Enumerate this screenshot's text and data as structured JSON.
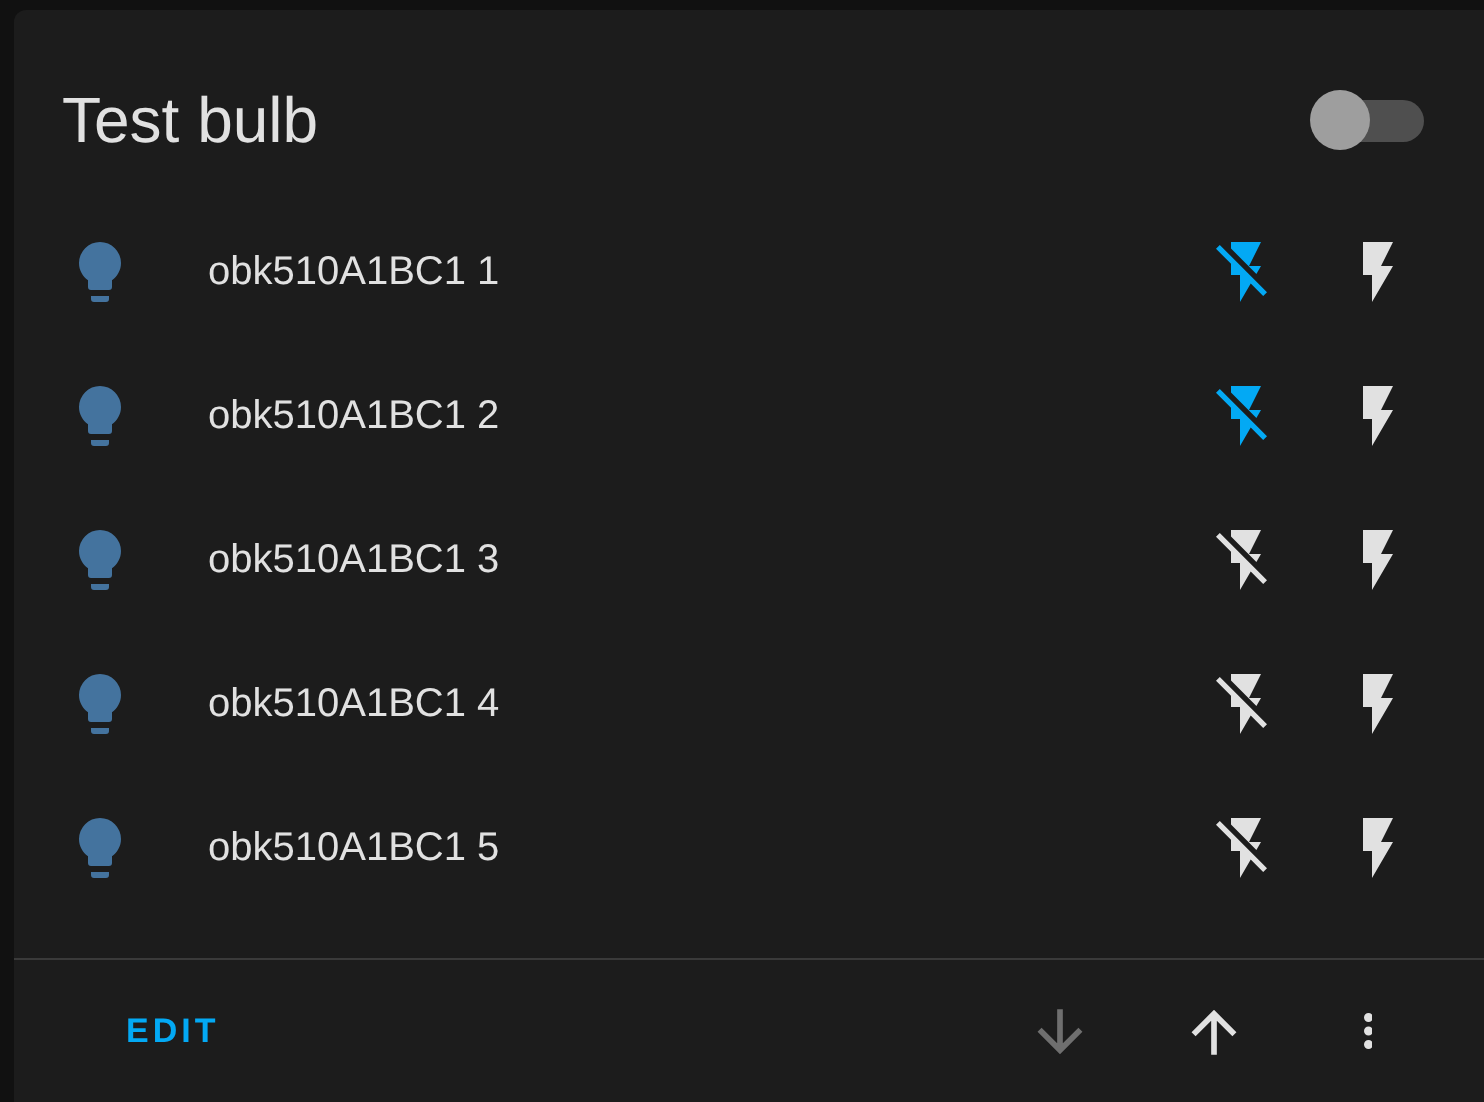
{
  "card": {
    "title": "Test bulb",
    "toggle": {
      "on": false
    }
  },
  "rows": [
    {
      "name": "obk510A1BC1 1",
      "buttons": [
        {
          "kind": "off",
          "selected": true
        },
        {
          "kind": "on",
          "selected": false
        }
      ]
    },
    {
      "name": "obk510A1BC1 2",
      "buttons": [
        {
          "kind": "off",
          "selected": true
        },
        {
          "kind": "on",
          "selected": false
        }
      ]
    },
    {
      "name": "obk510A1BC1 3",
      "buttons": [
        {
          "kind": "off",
          "selected": false
        },
        {
          "kind": "on",
          "selected": false
        }
      ]
    },
    {
      "name": "obk510A1BC1 4",
      "buttons": [
        {
          "kind": "off",
          "selected": false
        },
        {
          "kind": "on",
          "selected": false
        }
      ]
    },
    {
      "name": "obk510A1BC1 5",
      "buttons": [
        {
          "kind": "off",
          "selected": false
        },
        {
          "kind": "on",
          "selected": false
        }
      ]
    }
  ],
  "footer": {
    "edit": "EDIT",
    "actions": [
      {
        "kind": "down",
        "disabled": true
      },
      {
        "kind": "up",
        "disabled": false
      },
      {
        "kind": "more",
        "disabled": false
      }
    ]
  }
}
